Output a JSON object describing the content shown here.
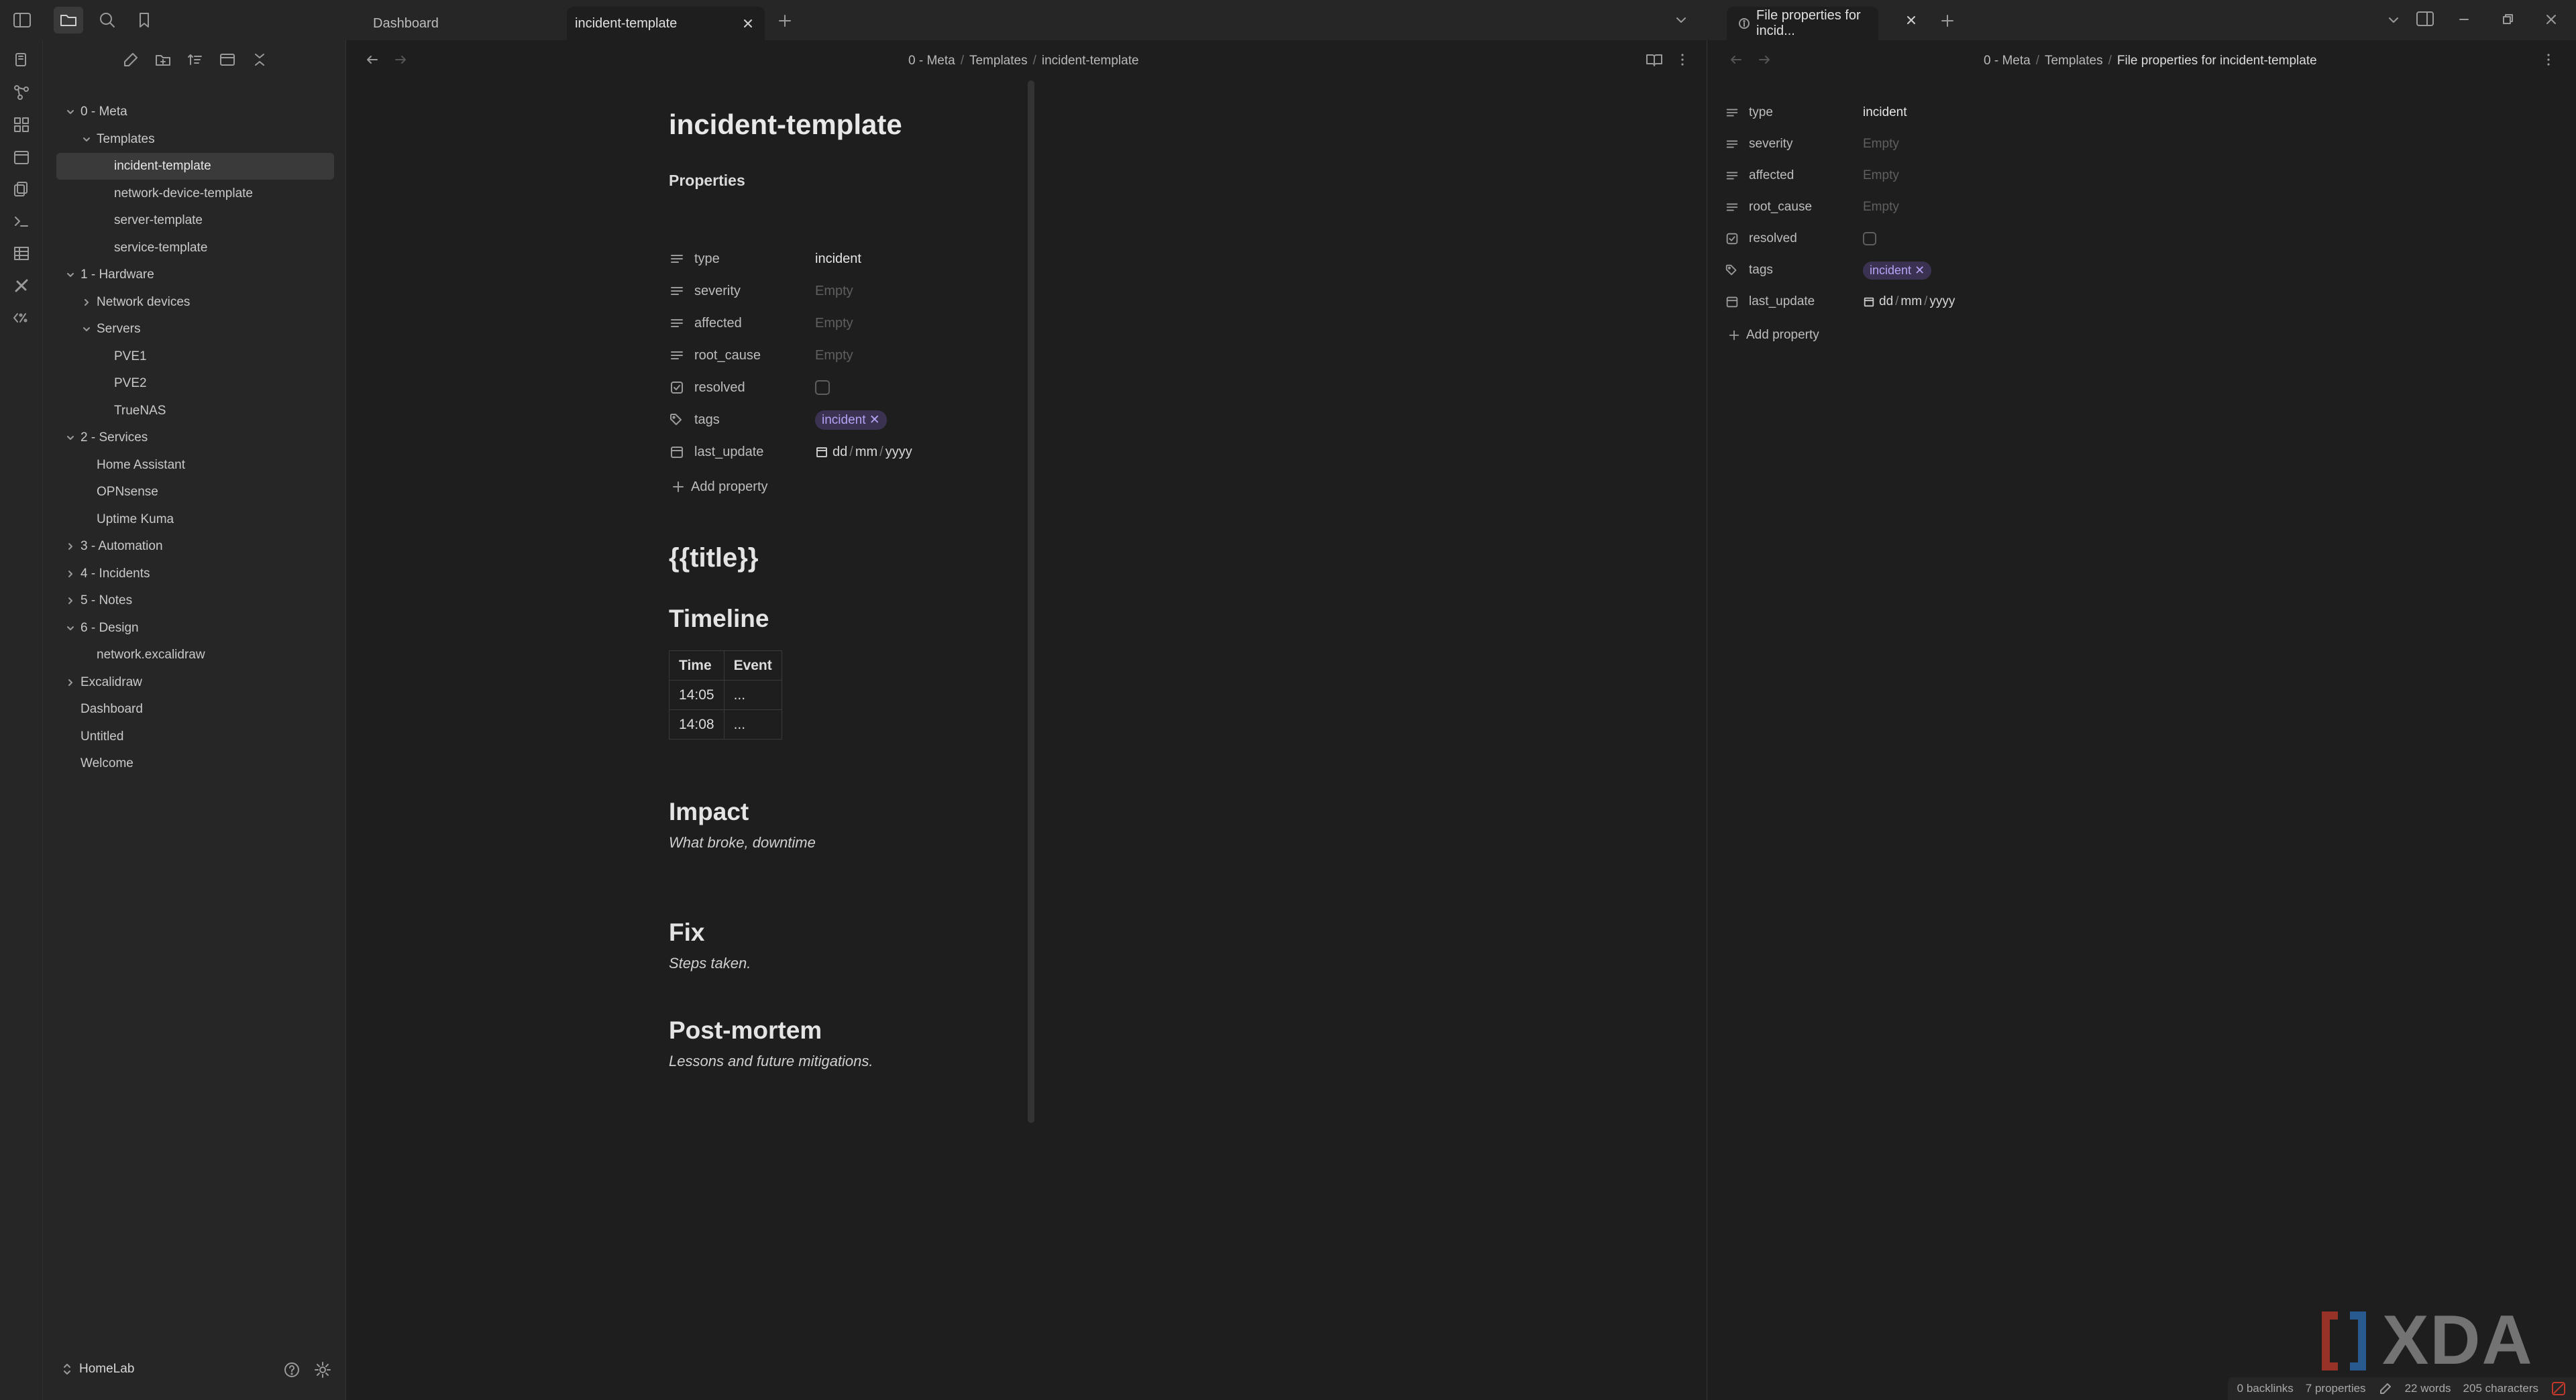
{
  "tabs": {
    "tab1": "Dashboard",
    "tab2": "incident-template",
    "tab_right": "File properties for incid..."
  },
  "breadcrumb": {
    "main": [
      "0 - Meta",
      "Templates",
      "incident-template"
    ],
    "right": [
      "0 - Meta",
      "Templates",
      "File properties for incident-template"
    ],
    "sep": "/"
  },
  "tree": {
    "meta": "0 - Meta",
    "templates": "Templates",
    "incident_template": "incident-template",
    "network_device_template": "network-device-template",
    "server_template": "server-template",
    "service_template": "service-template",
    "hardware": "1 - Hardware",
    "network_devices": "Network devices",
    "servers": "Servers",
    "pve1": "PVE1",
    "pve2": "PVE2",
    "truenas": "TrueNAS",
    "services": "2 - Services",
    "home_assistant": "Home Assistant",
    "opnsense": "OPNsense",
    "uptime_kuma": "Uptime Kuma",
    "automation": "3 - Automation",
    "incidents": "4 - Incidents",
    "notes": "5 - Notes",
    "design": "6 - Design",
    "network_excalidraw": "network.excalidraw",
    "excalidraw": "Excalidraw",
    "dashboard": "Dashboard",
    "untitled": "Untitled",
    "welcome": "Welcome"
  },
  "vault": {
    "name": "HomeLab"
  },
  "note": {
    "title": "incident-template",
    "properties_heading": "Properties",
    "props": {
      "type_key": "type",
      "type_val": "incident",
      "severity_key": "severity",
      "affected_key": "affected",
      "root_cause_key": "root_cause",
      "resolved_key": "resolved",
      "tags_key": "tags",
      "tag_val": "incident",
      "last_update_key": "last_update",
      "date_dd": "dd",
      "date_mm": "mm",
      "date_yyyy": "yyyy",
      "date_sep": "/",
      "empty": "Empty"
    },
    "add_property": "Add property",
    "heading_title": "{{title}}",
    "timeline": "Timeline",
    "table": {
      "h_time": "Time",
      "h_event": "Event",
      "r1_time": "14:05",
      "r1_event": "...",
      "r2_time": "14:08",
      "r2_event": "..."
    },
    "impact": "Impact",
    "impact_text": "What broke, downtime",
    "fix": "Fix",
    "fix_text": "Steps taken.",
    "postmortem": "Post-mortem",
    "postmortem_text": "Lessons and future mitigations."
  },
  "status": {
    "backlinks": "0 backlinks",
    "properties": "7 properties",
    "words": "22 words",
    "chars": "205 characters"
  },
  "watermark": "XDA",
  "colors": {
    "tag_bg": "#3b3252",
    "tag_fg": "#b6a2f5",
    "accent": "#8a6cf0"
  }
}
